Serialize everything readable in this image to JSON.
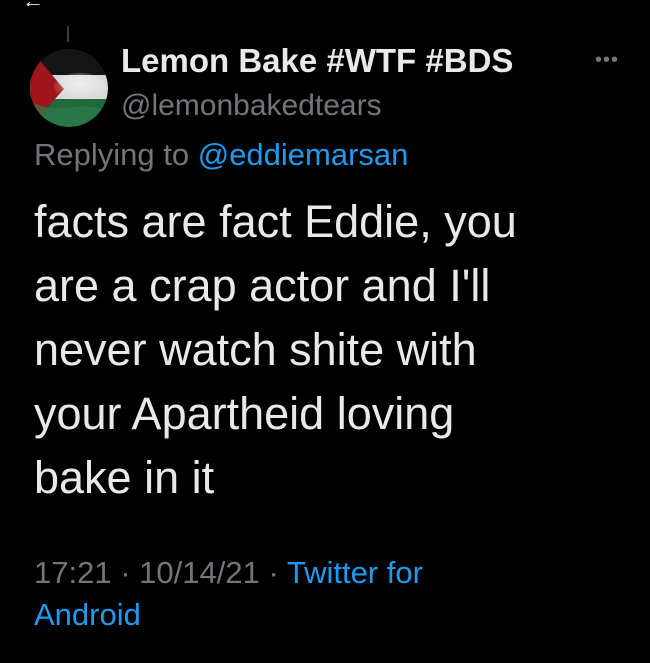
{
  "tweet": {
    "author_name": "Lemon Bake #WTF #BDS",
    "author_handle": "@lemonbakedtears",
    "replying_prefix": "Replying to",
    "replying_to": "@eddiemarsan",
    "text_lines": [
      "facts are fact Eddie, you",
      "are a crap actor and I'll",
      "never watch shite with",
      "your Apartheid loving",
      "bake in it"
    ],
    "time": "17:21",
    "separator": "·",
    "date": "10/14/21",
    "source_line1": "Twitter for",
    "source_line2": "Android",
    "more_icon": "•••"
  },
  "colors": {
    "background": "#000000",
    "primary_text": "#e7e9ea",
    "secondary_text": "#71767b",
    "link": "#1d9bf0"
  },
  "icons": {
    "avatar": "palestine-flag-avatar",
    "more": "more-options-icon",
    "back": "back-arrow-icon"
  }
}
